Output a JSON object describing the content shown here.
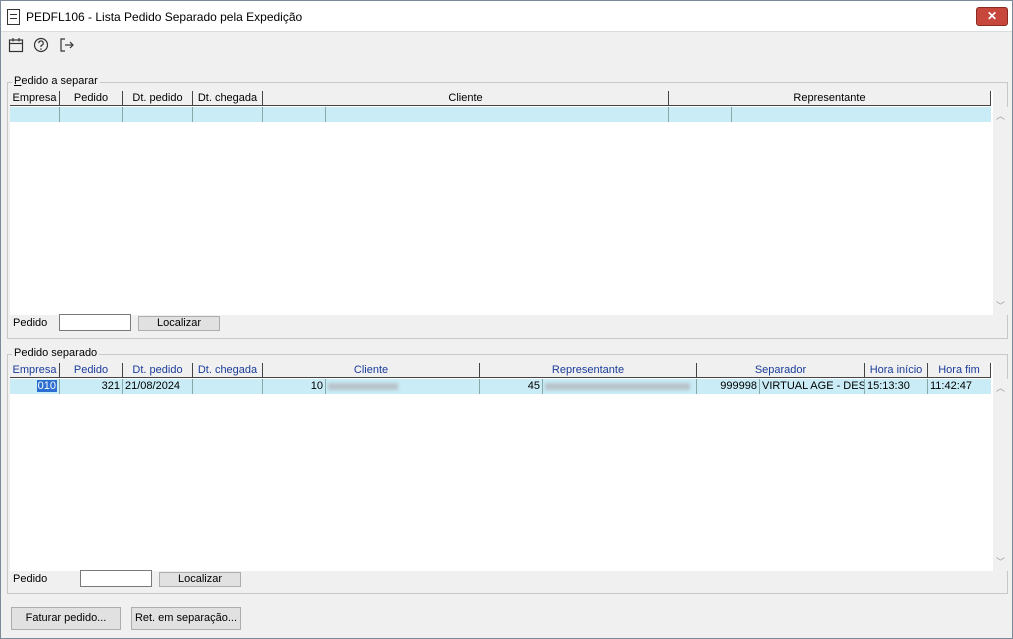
{
  "window": {
    "title": "PEDFL106 - Lista Pedido Separado pela Expedição",
    "close_label": "✕"
  },
  "toolbar": {
    "icons": [
      "calendar-icon",
      "help-icon",
      "exit-icon"
    ]
  },
  "pending": {
    "group_prefix": "P",
    "group_rest": "edido a separar",
    "columns": [
      "Empresa",
      "Pedido",
      "Dt. pedido",
      "Dt. chegada",
      "Cliente",
      "Representante"
    ],
    "filter_label": "Pedido",
    "filter_value": "",
    "find_label": "Localizar"
  },
  "separated": {
    "group_title": "Pedido separado",
    "columns": [
      "Empresa",
      "Pedido",
      "Dt. pedido",
      "Dt. chegada",
      "Cliente",
      "Representante",
      "Separador",
      "Hora início",
      "Hora fim"
    ],
    "rows": [
      {
        "empresa": "010",
        "pedido": "321",
        "dt_pedido": "21/08/2024",
        "dt_chegada": "",
        "cliente_cod": "10",
        "representante_cod": "45",
        "separador_cod": "999998",
        "separador_nome": "VIRTUAL AGE - DESE",
        "hora_inicio": "15:13:30",
        "hora_fim": "11:42:47"
      }
    ],
    "filter_label": "Pedido",
    "filter_value": "",
    "find_label": "Localizar"
  },
  "footer": {
    "invoice_label": "Faturar pedido...",
    "return_label": "Ret. em separação..."
  },
  "colors": {
    "header_text_blue": "#1a3c9a",
    "row_highlight": "#c9ecf6",
    "selection": "#2d6fd0",
    "close_red": "#c7473d"
  }
}
